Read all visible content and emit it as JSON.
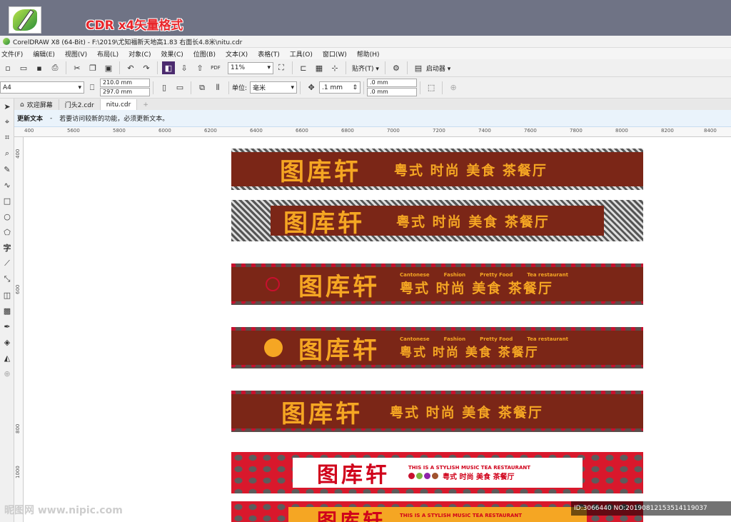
{
  "banner": {
    "label": "CDR x4矢量格式"
  },
  "window": {
    "title": "CorelDRAW X8 (64-Bit) - F:\\2019\\尤知福新天地高1.83 右面长4.8米\\nitu.cdr"
  },
  "menu": [
    "文件(F)",
    "编辑(E)",
    "视图(V)",
    "布局(L)",
    "对象(C)",
    "效果(C)",
    "位图(B)",
    "文本(X)",
    "表格(T)",
    "工具(O)",
    "窗口(W)",
    "帮助(H)"
  ],
  "toolbar": {
    "zoom": "11%",
    "snap_label": "贴齐(T)",
    "launcher_label": "启动器",
    "page_size": "A4",
    "width": "210.0 mm",
    "height": "297.0 mm",
    "unit_label": "单位:",
    "unit_value": "毫米",
    "nudge": ".1 mm",
    "dup_x": ".0 mm",
    "dup_y": ".0 mm"
  },
  "tabs": [
    {
      "label": "欢迎屏幕"
    },
    {
      "label": "门头2.cdr"
    },
    {
      "label": "nitu.cdr"
    }
  ],
  "hint": {
    "title": "更新文本",
    "sep": "-",
    "message": "若要访问较新的功能，必须更新文本。"
  },
  "ruler": {
    "h": [
      "400",
      "5600",
      "5800",
      "6000",
      "6200",
      "6400",
      "6600",
      "6800",
      "7000",
      "7200",
      "7400",
      "7600",
      "7800",
      "8000",
      "8200",
      "8400"
    ],
    "v": [
      "400",
      "600",
      "800",
      "1000"
    ]
  },
  "signs": {
    "brand": "图库轩",
    "slogan_1": "粤式 时尚 美食 茶餐厅",
    "slogan_2": "粤式 时尚 美食 茶餐厅",
    "slogan_3": "粤式 时尚 美食 茶餐厅",
    "slogan_4": "粤式 时尚 美食 茶餐厅",
    "slogan_5": "粤式 时尚 美食 茶餐厅",
    "en": [
      "Cantonese",
      "Fashion",
      "Pretty Food",
      "Tea restaurant"
    ],
    "en_4": [
      "Cantonese",
      "Fashion",
      "Pretty Food",
      "Tea restaurant"
    ],
    "tagline": "THIS IS A STYLISH MUSIC TEA RESTAURANT",
    "tagline_7": "THIS IS A STYLISH MUSIC TEA RESTAURANT",
    "slogan_6": "粤式 时尚 美食 茶餐厅",
    "dots": [
      "#c8102e",
      "#7cb342",
      "#8e24aa",
      "#a0522d"
    ]
  },
  "watermark": {
    "left": "昵图网 www.nipic.com",
    "right": "ID:3066440 NO:20190812153514119037"
  }
}
